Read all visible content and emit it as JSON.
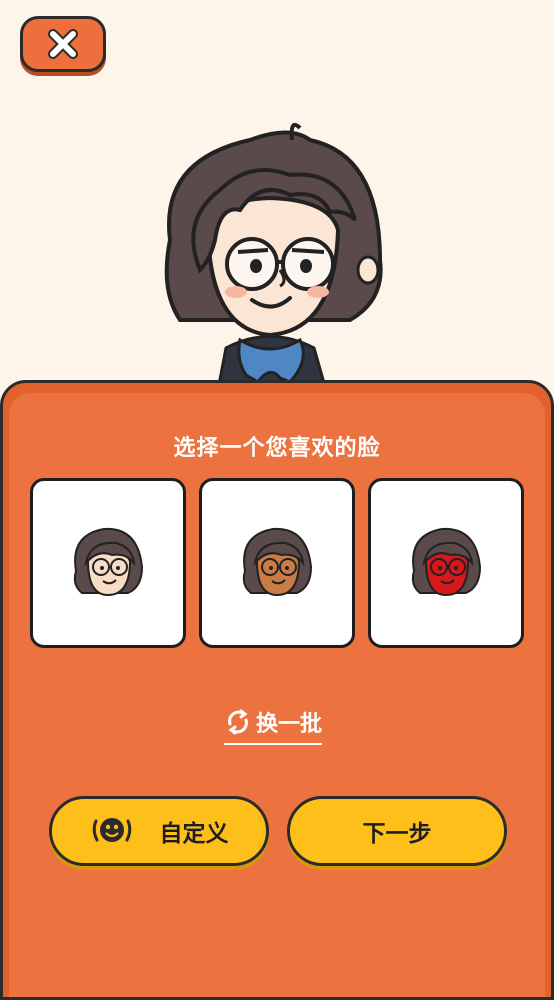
{
  "header": {
    "close_icon": "close-icon"
  },
  "panel": {
    "title": "选择一个您喜欢的脸",
    "faces": [
      {
        "id": "face-light",
        "skin": "#f8dcc4"
      },
      {
        "id": "face-tan",
        "skin": "#c97c45"
      },
      {
        "id": "face-red",
        "skin": "#d7191b"
      }
    ],
    "refresh_label": "换一批",
    "custom_label": "自定义",
    "next_label": "下一步"
  },
  "colors": {
    "accent": "#ec733f",
    "button_yellow": "#ffbf1a",
    "background": "#fdf5ea"
  }
}
